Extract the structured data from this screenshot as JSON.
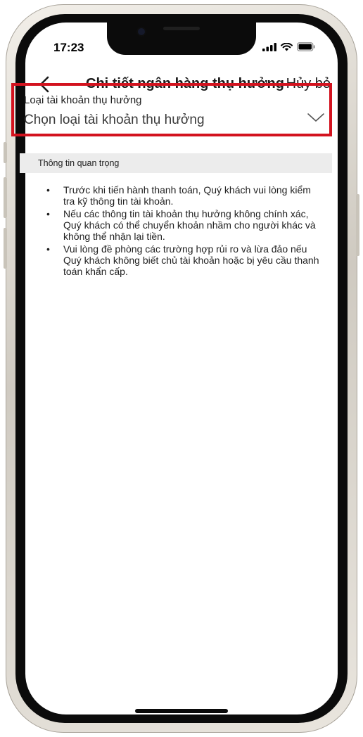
{
  "status_bar": {
    "time": "17:23",
    "signal_icon": "cellular-signal-icon",
    "wifi_icon": "wifi-icon",
    "battery_icon": "battery-icon"
  },
  "nav": {
    "back_icon": "chevron-left-icon",
    "title": "Chi tiết ngân hàng thụ hưởng",
    "cancel_label": "Hủy bỏ"
  },
  "account_type_field": {
    "label": "Loại tài khoản thụ hưởng",
    "placeholder": "Chọn loại tài khoản thụ hưởng",
    "dropdown_icon": "chevron-down-icon",
    "highlight_color": "#d3131f"
  },
  "important_info": {
    "title": "Thông tin quan trọng",
    "bullet": "•",
    "items": [
      "Trước khi tiến hành thanh toán, Quý khách vui lòng kiểm tra kỹ thông tin tài khoản.",
      "Nếu các thông tin tài khoản thụ hưởng không chính xác, Quý khách có thể chuyển khoản nhầm cho người khác và không thể nhận lại tiền.",
      "Vui lòng đề phòng các trường hợp rủi ro và lừa đảo nếu Quý khách không biết chủ tài khoản hoặc bị yêu cầu thanh toán khẩn cấp."
    ]
  }
}
